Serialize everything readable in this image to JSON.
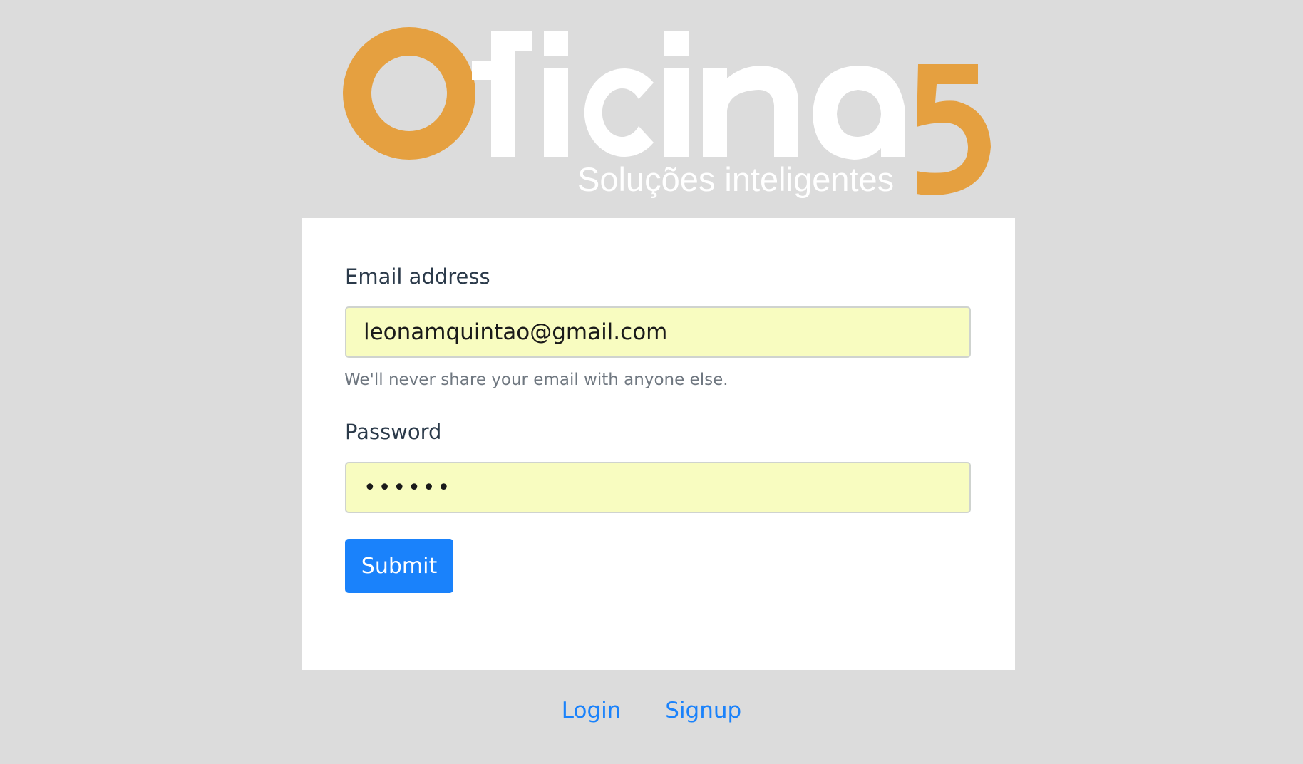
{
  "logo": {
    "wordmark": "Oficina5",
    "tagline": "Soluções inteligentes",
    "colors": {
      "accent": "#e5a040",
      "text": "#ffffff"
    }
  },
  "form": {
    "email": {
      "label": "Email address",
      "value": "leonamquintao@gmail.com",
      "help": "We'll never share your email with anyone else."
    },
    "password": {
      "label": "Password",
      "value": "••••••"
    },
    "submit_label": "Submit"
  },
  "footer": {
    "links": [
      {
        "label": "Login"
      },
      {
        "label": "Signup"
      }
    ]
  },
  "colors": {
    "background": "#dcdcdc",
    "card": "#ffffff",
    "input_autofill": "#f8fcc0",
    "primary": "#1a82fb",
    "label_text": "#2b3a4a",
    "help_text": "#6f7780"
  }
}
